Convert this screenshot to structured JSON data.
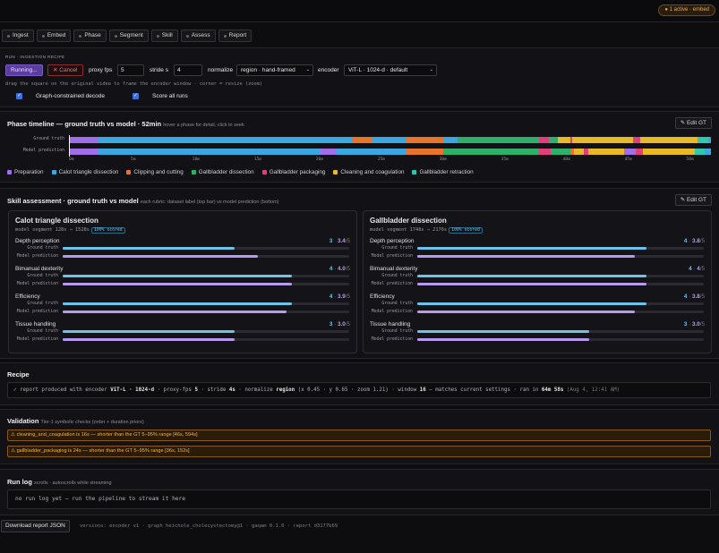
{
  "top": {
    "badge": "● 1 active · embed"
  },
  "tabs": [
    "Ingest",
    "Embed",
    "Phase",
    "Segment",
    "Skill",
    "Assess",
    "Report"
  ],
  "run": {
    "section_label": "RUN · INGESTION RECIPE",
    "running_label": "Running...",
    "cancel_label": "✕ Cancel",
    "proxy_fps_label": "proxy fps",
    "proxy_fps_value": "5",
    "stride_label": "stride s",
    "stride_value": "4",
    "normalize_label": "normalize",
    "normalize_value": "region · hand-framed",
    "encoder_label": "encoder",
    "encoder_value": "ViT-L · 1024-d · default",
    "hint": "drag the square on the original video to frame the encoder window · corner = resize (zoom)",
    "graph_label": "Graph-constrained decode",
    "score_label": "Score all runs"
  },
  "timeline": {
    "title": "Phase timeline — ground truth vs model · 52min",
    "subtitle": "hover a phase for detail, click to seek",
    "edit_label": "✎ Edit GT",
    "row1": "Ground truth",
    "row2": "Model prediction",
    "ticks": [
      "0m",
      "5m",
      "10m",
      "15m",
      "20m",
      "25m",
      "30m",
      "35m",
      "40m",
      "45m",
      "50m"
    ],
    "duration_min": 52,
    "gt_segments": [
      {
        "phase": 0,
        "start": 0,
        "end": 2.3
      },
      {
        "phase": 1,
        "start": 2.3,
        "end": 23.0
      },
      {
        "phase": 2,
        "start": 23.0,
        "end": 24.6
      },
      {
        "phase": 1,
        "start": 24.6,
        "end": 27.3
      },
      {
        "phase": 2,
        "start": 27.3,
        "end": 30.3
      },
      {
        "phase": 1,
        "start": 30.3,
        "end": 31.5
      },
      {
        "phase": 3,
        "start": 31.5,
        "end": 38.1
      },
      {
        "phase": 4,
        "start": 38.1,
        "end": 38.9
      },
      {
        "phase": 3,
        "start": 38.9,
        "end": 39.6
      },
      {
        "phase": 5,
        "start": 39.6,
        "end": 40.6
      },
      {
        "phase": 4,
        "start": 40.6,
        "end": 40.8
      },
      {
        "phase": 5,
        "start": 40.8,
        "end": 45.7
      },
      {
        "phase": 4,
        "start": 45.7,
        "end": 46.3
      },
      {
        "phase": 5,
        "start": 46.3,
        "end": 50.9
      },
      {
        "phase": 6,
        "start": 50.9,
        "end": 51.8
      },
      {
        "phase": 1,
        "start": 51.8,
        "end": 52
      }
    ],
    "pred_segments": [
      {
        "phase": 0,
        "start": 0,
        "end": 2.3
      },
      {
        "phase": 1,
        "start": 2.3,
        "end": 20.4
      },
      {
        "phase": 0,
        "start": 20.4,
        "end": 21.6
      },
      {
        "phase": 1,
        "start": 21.6,
        "end": 27.3
      },
      {
        "phase": 2,
        "start": 27.3,
        "end": 30.3
      },
      {
        "phase": 3,
        "start": 30.3,
        "end": 38.1
      },
      {
        "phase": 4,
        "start": 38.1,
        "end": 39.0
      },
      {
        "phase": 3,
        "start": 39.0,
        "end": 40.6
      },
      {
        "phase": 2,
        "start": 40.6,
        "end": 40.9
      },
      {
        "phase": 5,
        "start": 40.9,
        "end": 41.7
      },
      {
        "phase": 4,
        "start": 41.7,
        "end": 42.1
      },
      {
        "phase": 5,
        "start": 42.1,
        "end": 45.0
      },
      {
        "phase": 0,
        "start": 45.0,
        "end": 45.9
      },
      {
        "phase": 4,
        "start": 45.9,
        "end": 46.5
      },
      {
        "phase": 5,
        "start": 46.5,
        "end": 50.7
      },
      {
        "phase": 6,
        "start": 50.7,
        "end": 51.5
      },
      {
        "phase": 1,
        "start": 51.5,
        "end": 52
      }
    ],
    "legend": [
      {
        "name": "Preparation",
        "color": "#a06ee8"
      },
      {
        "name": "Calot triangle dissection",
        "color": "#3aa7e0"
      },
      {
        "name": "Clipping and cutting",
        "color": "#e8742c"
      },
      {
        "name": "Gallbladder dissection",
        "color": "#2fb06a"
      },
      {
        "name": "Gallbladder packaging",
        "color": "#e0407a"
      },
      {
        "name": "Cleaning and coagulation",
        "color": "#e8b825"
      },
      {
        "name": "Gallbladder retraction",
        "color": "#2fc8b0"
      }
    ]
  },
  "skill": {
    "title": "Skill assessment · ground truth vs model",
    "subtitle": "each rubric: dataset label (top bar) vs model prediction (bottom)",
    "edit_label": "✎ Edit GT",
    "gt_label": "Ground truth",
    "pred_label": "Model prediction",
    "slash": "/5",
    "dot": " · ",
    "cards": [
      {
        "title": "Calot triangle dissection",
        "segment": "model segment 128s → 1528s",
        "scored": "100% scored",
        "metrics": [
          {
            "name": "Depth perception",
            "gt": "3",
            "pred": "3.4",
            "gt_frac": 0.6,
            "pred_frac": 0.68
          },
          {
            "name": "Bimanual dexterity",
            "gt": "4",
            "pred": "4.0",
            "gt_frac": 0.8,
            "pred_frac": 0.8
          },
          {
            "name": "Efficiency",
            "gt": "4",
            "pred": "3.9",
            "gt_frac": 0.8,
            "pred_frac": 0.78
          },
          {
            "name": "Tissue handling",
            "gt": "3",
            "pred": "3.0",
            "gt_frac": 0.6,
            "pred_frac": 0.6
          }
        ]
      },
      {
        "title": "Gallbladder dissection",
        "segment": "model segment 1748s → 2176s",
        "scored": "100% scored",
        "metrics": [
          {
            "name": "Depth perception",
            "gt": "4",
            "pred": "3.8",
            "gt_frac": 0.8,
            "pred_frac": 0.76
          },
          {
            "name": "Bimanual dexterity",
            "gt": "4",
            "pred": "4",
            "gt_frac": 0.8,
            "pred_frac": 0.8
          },
          {
            "name": "Efficiency",
            "gt": "4",
            "pred": "3.8",
            "gt_frac": 0.8,
            "pred_frac": 0.76
          },
          {
            "name": "Tissue handling",
            "gt": "3",
            "pred": "3.0",
            "gt_frac": 0.6,
            "pred_frac": 0.6
          }
        ]
      }
    ]
  },
  "recipe": {
    "title": "Recipe",
    "p1": "✓ report produced with encoder ",
    "enc": "ViT-L · 1024-d",
    "p2": " · proxy-fps ",
    "fps": "5",
    "p3": " · stride ",
    "stride": "4s",
    "p4": " · normalize ",
    "norm": "region",
    "p5": " (x 0.45 · y 0.65 · zoom 1.21) · window ",
    "win": "16",
    "p6": " — matches current settings · ran in ",
    "ran": "64m 58s",
    "p7": " (Aug 4, 12:41 AM)"
  },
  "validation": {
    "title": "Validation",
    "subtitle": "Tier-1 symbolic checks (order + duration priors)",
    "warnings": [
      "⚠ cleaning_and_coagulation is 16s — shorter than the GT 5–95% range [46s, 594s]",
      "⚠ gallbladder_packaging is 24s — shorter than the GT 5–95% range [36s, 152s]"
    ]
  },
  "runlog": {
    "title": "Run log",
    "subtitle": "scrolls · autoscrolls while streaming",
    "empty": "no run log yet — run the pipeline to stream it here"
  },
  "footer": {
    "download_label": "Download report JSON",
    "versions": "versions: encoder v1 · graph heichole_cholecystectomy@1 · gaqam 0.1.0 · report d3177b69"
  }
}
